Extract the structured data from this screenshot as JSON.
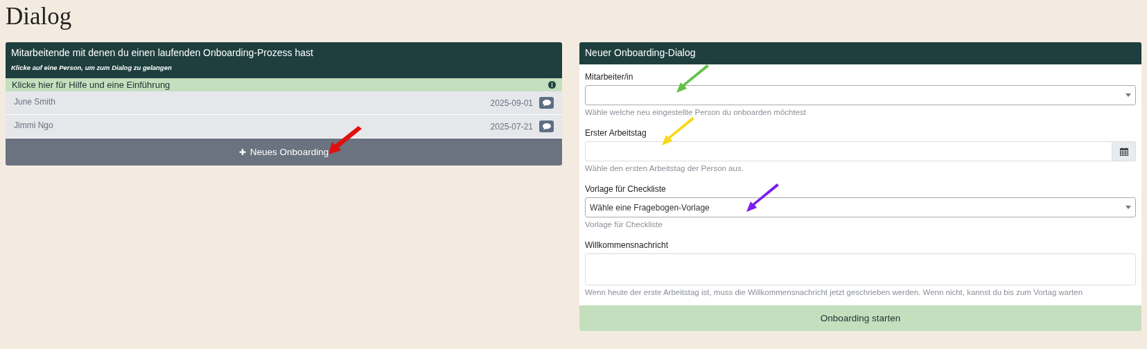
{
  "page_title": "Dialog",
  "onboarding_list": {
    "title": "Mitarbeitende mit denen du einen laufenden Onboarding-Prozess hast",
    "subtitle": "Klicke auf eine Person, um zum Dialog zu gelangen",
    "help_link": "Klicke hier für Hilfe und eine Einführung",
    "rows": [
      {
        "name": "June Smith",
        "date": "2025-09-01"
      },
      {
        "name": "Jimmi Ngo",
        "date": "2025-07-21"
      }
    ],
    "new_button": {
      "icon": "✚",
      "label": "Neues Onboarding",
      "arrow": {
        "color": "#e20f0f"
      }
    }
  },
  "new_dialog": {
    "title": "Neuer Onboarding-Dialog",
    "fields": [
      {
        "kind": "select",
        "label": "Mitarbeiter/in",
        "help": "Wähle welche neu eingestellte Person du onboarden möchtest",
        "arrow": {
          "color": "#62c245"
        }
      },
      {
        "kind": "date",
        "label": "Erster Arbeitstag",
        "help": "Wähle den ersten Arbeitstag der Person aus.",
        "arrow": {
          "color": "#f8d818"
        }
      },
      {
        "kind": "select",
        "label": "Vorlage für Checkliste",
        "value": "Wähle eine Fragebogen-Vorlage",
        "help": "Vorlage für Checkliste",
        "arrow": {
          "color": "#7a1ff0"
        }
      },
      {
        "kind": "textarea",
        "label": "Willkommensnachricht",
        "help": "Wenn heute der erste Arbeitstag ist, muss die Willkommensnachricht jetzt geschrieben werden. Wenn nicht, kannst du bis zum Vortag warten"
      }
    ],
    "submit_button": "Onboarding starten"
  }
}
